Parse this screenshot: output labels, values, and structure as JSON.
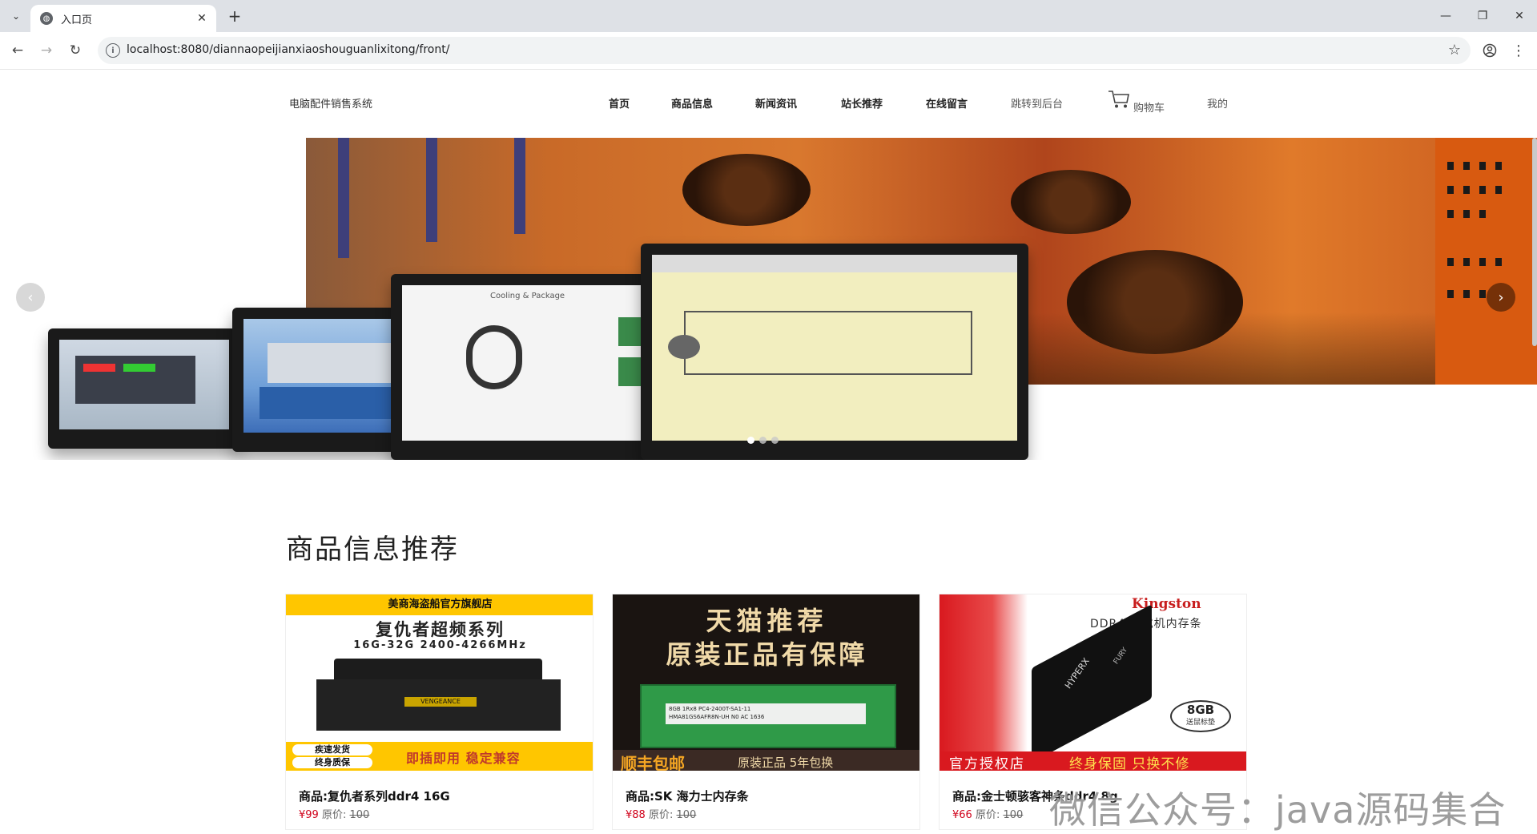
{
  "browser": {
    "tab_title": "入口页",
    "url": "localhost:8080/diannaopeijianxiaoshouguanlixitong/front/"
  },
  "site": {
    "brand": "电脑配件销售系统",
    "nav": [
      {
        "label": "首页"
      },
      {
        "label": "商品信息"
      },
      {
        "label": "新闻资讯"
      },
      {
        "label": "站长推荐"
      },
      {
        "label": "在线留言"
      },
      {
        "label": "跳转到后台"
      },
      {
        "label": "购物车"
      },
      {
        "label": "我的"
      }
    ]
  },
  "carousel": {
    "slides": 3,
    "active_slide": 1
  },
  "section": {
    "title": "商品信息推荐"
  },
  "products": [
    {
      "name": "商品:复仇者系列ddr4 16G",
      "price": "¥99",
      "orig_label": "原价:",
      "orig_price": "100",
      "img": {
        "top": "美商海盗船官方旗舰店",
        "headline": "复仇者超频系列",
        "spec": "16G-32G 2400-4266MHz",
        "module_label": "VENGEANCE",
        "badge1": "疾速发货",
        "badge2": "终身质保",
        "bottom": "即插即用 稳定兼容"
      }
    },
    {
      "name": "商品:SK 海力士内存条",
      "price": "¥88",
      "orig_label": "原价:",
      "orig_price": "100",
      "img": {
        "line1": "天猫推荐",
        "line2": "原装正品有保障",
        "bottom_left": "顺丰包邮",
        "bottom_right": "原装正品 5年包换",
        "module_text": "8GB 1Rx8 PC4-2400T-SA1-11",
        "module_code": "HMA81GS6AFR8N-UH N0 AC 1636"
      }
    },
    {
      "name": "商品:金士顿骇客神条ddr4 8g",
      "price": "¥66",
      "orig_label": "原价:",
      "orig_price": "100",
      "img": {
        "brand": "Kingston",
        "line1": "DDR4 台式机内存条",
        "capacity": "8GB",
        "capacity_sub": "送鼠标垫",
        "bottom_left": "官方授权店",
        "bottom_right": "终身保固 只换不修",
        "module_label": "HYPERX",
        "module_label2": "FURY"
      }
    }
  ],
  "watermark": "微信公众号：java源码集合",
  "colors": {
    "price": "#d0021b",
    "chrome_bg": "#dee1e6",
    "card1_yellow": "#ffc600",
    "card3_red": "#d9191f"
  }
}
